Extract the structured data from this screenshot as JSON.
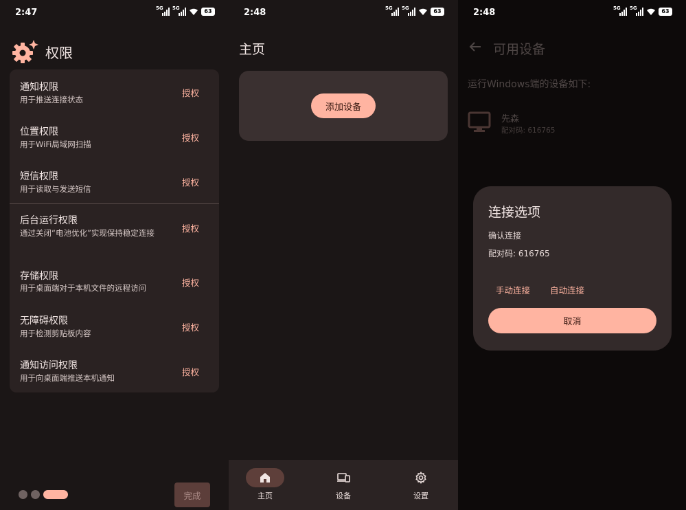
{
  "status_bars": [
    {
      "time": "2:47",
      "network": "5G",
      "battery": "63"
    },
    {
      "time": "2:48",
      "network": "5G",
      "battery": "63"
    },
    {
      "time": "2:48",
      "network": "5G",
      "battery": "63"
    }
  ],
  "permissions": {
    "title": "权限",
    "icon": "gear-sparkle-icon",
    "items": [
      {
        "title": "通知权限",
        "desc": "用于推送连接状态",
        "action": "授权"
      },
      {
        "title": "位置权限",
        "desc": "用于WiFi局域网扫描",
        "action": "授权"
      },
      {
        "title": "短信权限",
        "desc": "用于读取与发送短信",
        "action": "授权"
      },
      {
        "title": "后台运行权限",
        "desc": "通过关闭“电池优化”实现保持稳定连接",
        "action": "授权"
      },
      {
        "title": "存储权限",
        "desc": "用于桌面端对于本机文件的远程访问",
        "action": "授权"
      },
      {
        "title": "无障碍权限",
        "desc": "用于检测剪贴板内容",
        "action": "授权"
      },
      {
        "title": "通知访问权限",
        "desc": "用于向桌面端推送本机通知",
        "action": "授权"
      }
    ],
    "page_indicator": {
      "total": 3,
      "current": 3
    },
    "done_label": "完成"
  },
  "home": {
    "title": "主页",
    "add_device_label": "添加设备",
    "nav": [
      {
        "label": "主页",
        "icon": "home-icon",
        "active": true
      },
      {
        "label": "设备",
        "icon": "devices-icon",
        "active": false
      },
      {
        "label": "设置",
        "icon": "settings-icon",
        "active": false
      }
    ]
  },
  "devices": {
    "title": "可用设备",
    "subtitle": "运行Windows端的设备如下:",
    "device": {
      "name": "先森",
      "code": "配对码: 616765",
      "icon": "monitor-icon"
    },
    "dialog": {
      "title": "连接选项",
      "line1": "确认连接",
      "line2": "配对码: 616765",
      "manual_label": "手动连接",
      "auto_label": "自动连接",
      "cancel_label": "取消"
    }
  },
  "colors": {
    "accent": "#FFB4A1",
    "background": "#1B1616",
    "card": "#2A2222",
    "dialog": "#332A2A"
  }
}
